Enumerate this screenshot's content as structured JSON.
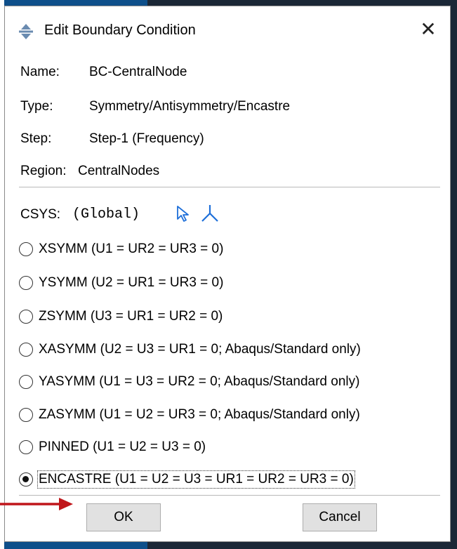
{
  "dialog": {
    "title": "Edit Boundary Condition",
    "close_glyph": "✕"
  },
  "info": {
    "name_label": "Name:",
    "name_value": "BC-CentralNode",
    "type_label": "Type:",
    "type_value": "Symmetry/Antisymmetry/Encastre",
    "step_label": "Step:",
    "step_value": "Step-1 (Frequency)",
    "region_label": "Region:",
    "region_value": "CentralNodes"
  },
  "csys": {
    "label": "CSYS:",
    "value": "(Global)",
    "select_icon": "cursor-arrow-icon",
    "axes_icon": "csys-axes-icon"
  },
  "options": [
    {
      "label": "XSYMM (U1 = UR2 = UR3 = 0)",
      "selected": false
    },
    {
      "label": "YSYMM (U2 = UR1 = UR3 = 0)",
      "selected": false
    },
    {
      "label": "ZSYMM (U3 = UR1 = UR2 = 0)",
      "selected": false
    },
    {
      "label": "XASYMM (U2 = U3 = UR1 = 0; Abaqus/Standard only)",
      "selected": false
    },
    {
      "label": "YASYMM (U1 = U3 = UR2 = 0; Abaqus/Standard only)",
      "selected": false
    },
    {
      "label": "ZASYMM (U1 = U2 = UR3 = 0; Abaqus/Standard only)",
      "selected": false
    },
    {
      "label": "PINNED (U1 = U2 = U3 = 0)",
      "selected": false
    },
    {
      "label": "ENCASTRE (U1 = U2 = U3 = UR1 = UR2 = UR3 = 0)",
      "selected": true
    }
  ],
  "buttons": {
    "ok_label": "OK",
    "cancel_label": "Cancel"
  },
  "colors": {
    "accent_icon": "#1e6fd9",
    "annotation_arrow": "#c0161b",
    "app_background": "#1b2736"
  }
}
